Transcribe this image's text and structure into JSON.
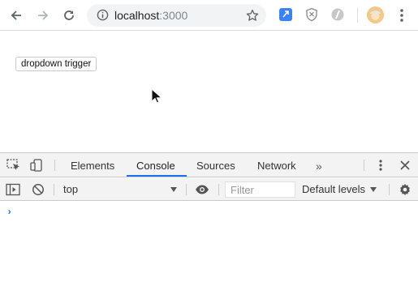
{
  "browser": {
    "back_icon": "back-arrow-icon",
    "forward_icon": "forward-arrow-icon",
    "reload_icon": "reload-icon",
    "url_host": "localhost",
    "url_port": ":3000",
    "bookmark_icon": "star-icon",
    "extensions": [
      "blue-extension-icon",
      "shield-extension-icon",
      "gray-extension-icon"
    ],
    "profile_icon": "avatar",
    "menu_icon": "kebab-menu-icon"
  },
  "page": {
    "dropdown_trigger_label": "dropdown trigger"
  },
  "devtools": {
    "tabs": [
      {
        "label": "Elements",
        "active": false
      },
      {
        "label": "Console",
        "active": true
      },
      {
        "label": "Sources",
        "active": false
      },
      {
        "label": "Network",
        "active": false
      }
    ],
    "overflow_label": "»",
    "context": "top",
    "filter_placeholder": "Filter",
    "levels": "Default levels",
    "prompt": "›",
    "accent": "#1a73e8"
  }
}
